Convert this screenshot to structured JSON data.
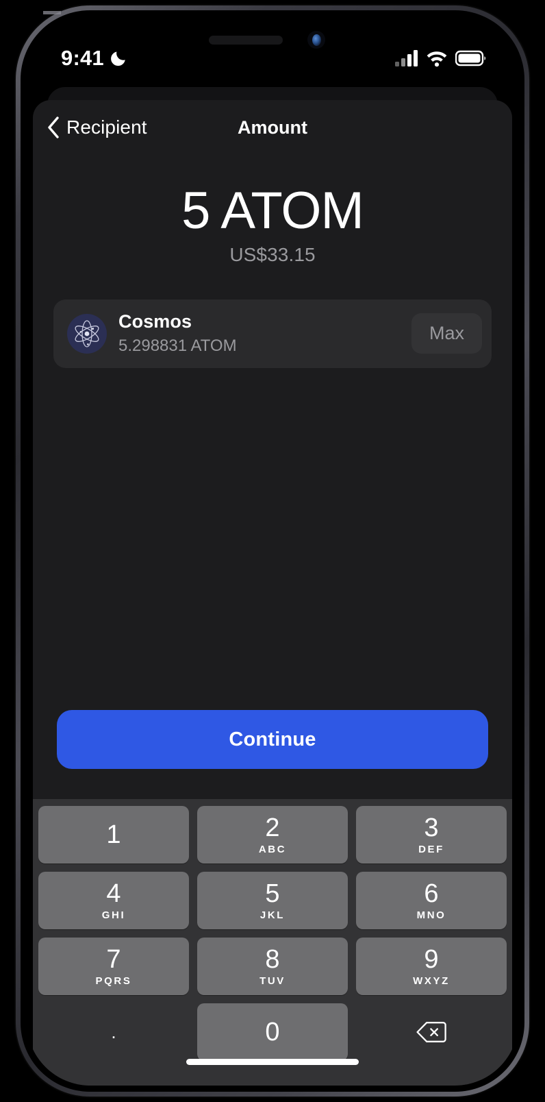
{
  "status_bar": {
    "time": "9:41",
    "dnd_icon": "crescent-moon-icon",
    "cellular_icon": "signal-bars-icon",
    "wifi_icon": "wifi-icon",
    "battery_icon": "battery-full-icon"
  },
  "navbar": {
    "back_label": "Recipient",
    "back_icon": "chevron-left-icon",
    "title": "Amount"
  },
  "amount": {
    "value": "5 ATOM",
    "fiat": "US$33.15"
  },
  "asset": {
    "logo_icon": "cosmos-atom-icon",
    "name": "Cosmos",
    "balance": "5.298831 ATOM",
    "max_label": "Max"
  },
  "primary_action": {
    "label": "Continue"
  },
  "keypad": {
    "rows": [
      [
        {
          "digit": "1",
          "letters": ""
        },
        {
          "digit": "2",
          "letters": "ABC"
        },
        {
          "digit": "3",
          "letters": "DEF"
        }
      ],
      [
        {
          "digit": "4",
          "letters": "GHI"
        },
        {
          "digit": "5",
          "letters": "JKL"
        },
        {
          "digit": "6",
          "letters": "MNO"
        }
      ],
      [
        {
          "digit": "7",
          "letters": "PQRS"
        },
        {
          "digit": "8",
          "letters": "TUV"
        },
        {
          "digit": "9",
          "letters": "WXYZ"
        }
      ]
    ],
    "decimal_key": ".",
    "zero_key": "0",
    "backspace_icon": "backspace-delete-icon"
  },
  "colors": {
    "accent_blue": "#2F58E4",
    "sheet_background": "#1C1C1E",
    "card_background": "#2A2A2C",
    "keypad_background": "#333335",
    "key_fill": "#6E6E70",
    "secondary_text": "#9A9A9E",
    "cosmos_logo_background": "#2B2F54"
  }
}
